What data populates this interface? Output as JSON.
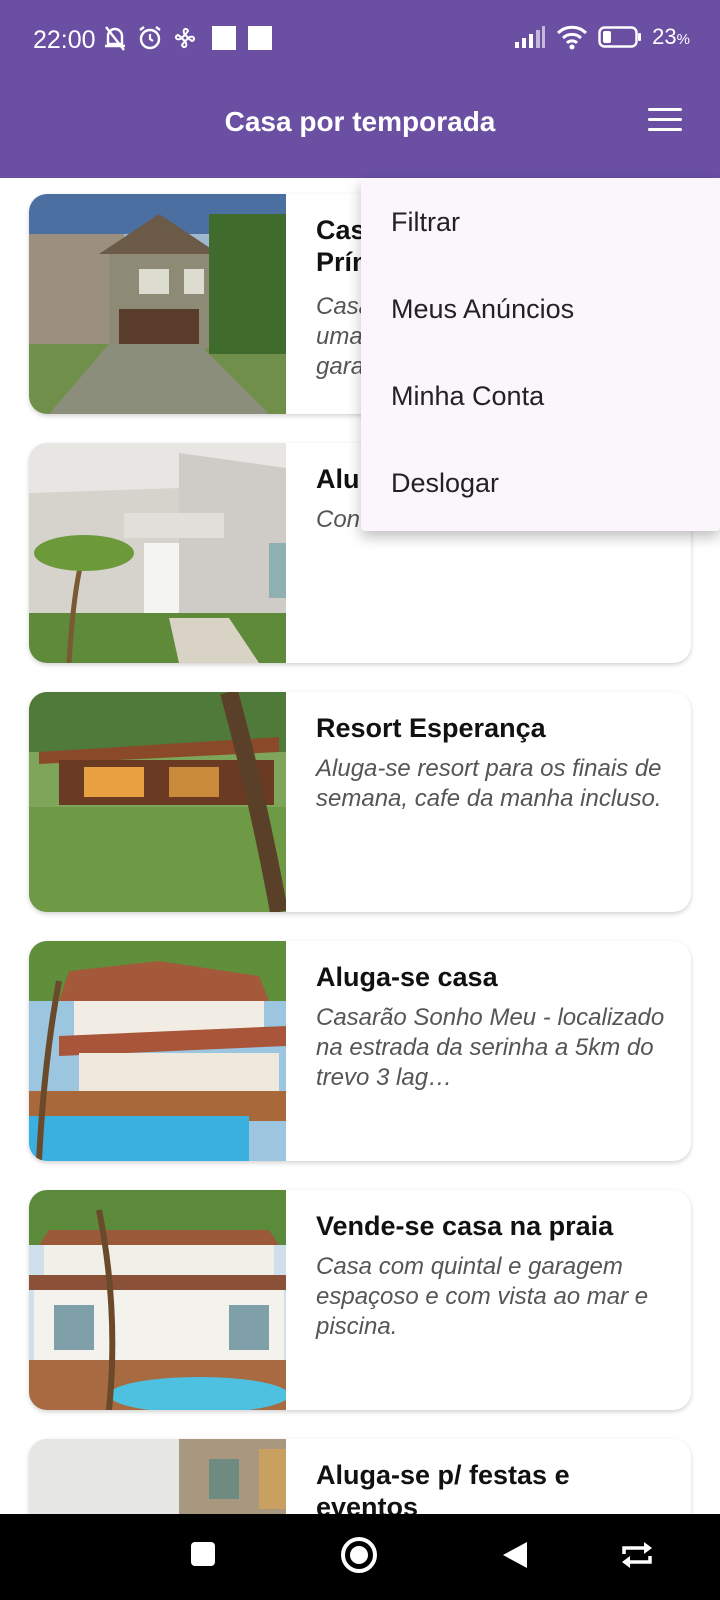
{
  "status": {
    "time": "22:00",
    "battery": "23",
    "battery_unit": "%"
  },
  "appbar": {
    "title": "Casa por temporada",
    "menu_icon": "hamburger-menu-icon"
  },
  "menu": {
    "items": [
      {
        "label": "Filtrar"
      },
      {
        "label": "Meus Anúncios"
      },
      {
        "label": "Minha Conta"
      },
      {
        "label": "Deslogar"
      }
    ]
  },
  "listings": [
    {
      "title": "Cas\nPrín",
      "desc": "Casa\numa\ngara"
    },
    {
      "title": "Alu",
      "desc": "Con"
    },
    {
      "title": "Resort Esperança",
      "desc": "Aluga-se resort para os finais de semana, cafe da manha incluso."
    },
    {
      "title": "Aluga-se casa",
      "desc": "Casarão Sonho Meu - localizado na estrada da serinha a 5km do trevo 3 lag…"
    },
    {
      "title": "Vende-se casa na praia",
      "desc": "Casa com quintal e garagem espaçoso e com vista ao mar e piscina."
    },
    {
      "title": "Aluga-se p/ festas e eventos",
      "desc": ""
    }
  ],
  "colors": {
    "primary": "#6a4fa3",
    "menu_bg": "#fbf6fc"
  }
}
